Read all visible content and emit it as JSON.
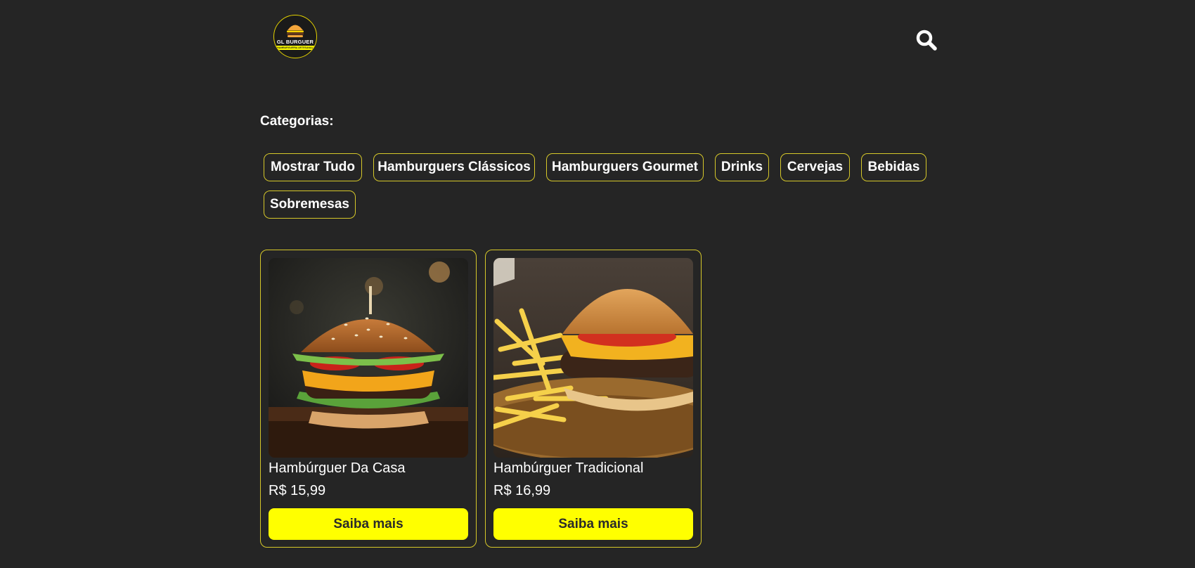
{
  "brand": {
    "name": "GL BURGUER",
    "tagline": "HAMBURGUERIA ARTESANAL",
    "accent_color": "#ffff00",
    "border_color": "#d6c82a",
    "background_color": "#252525"
  },
  "header": {
    "search_icon": "search-icon"
  },
  "categories": {
    "title": "Categorias:",
    "items": [
      "Mostrar Tudo",
      "Hamburguers Clássicos",
      "Hamburguers Gourmet",
      "Drinks",
      "Cervejas",
      "Bebidas",
      "Sobremesas"
    ]
  },
  "products": [
    {
      "name": "Hambúrguer Da Casa",
      "price": "R$ 15,99",
      "button": "Saiba mais"
    },
    {
      "name": "Hambúrguer Tradicional",
      "price": "R$ 16,99",
      "button": "Saiba mais"
    }
  ]
}
